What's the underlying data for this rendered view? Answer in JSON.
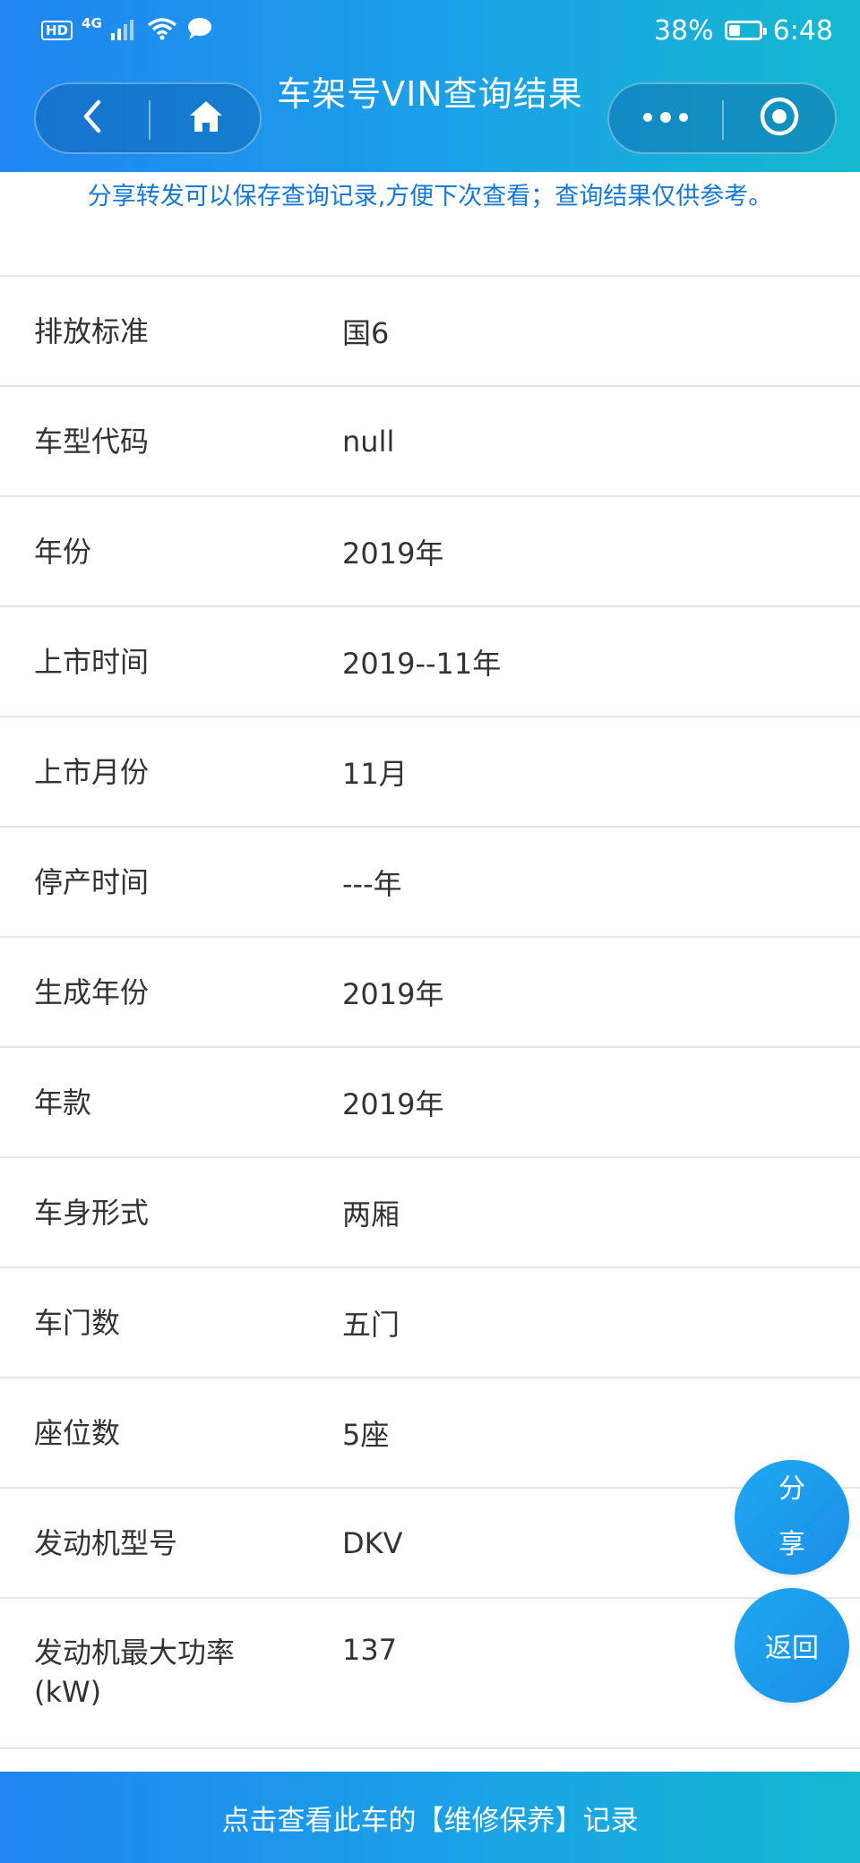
{
  "status_bar": {
    "hd": "HD",
    "network": "4G",
    "battery": "38%",
    "battery_level": 0.38,
    "time": "6:48"
  },
  "nav": {
    "title": "车架号VIN查询结果",
    "back_icon": "chevron-left-icon",
    "home_icon": "home-icon",
    "more_icon": "more-dots-icon",
    "close_icon": "target-circle-icon"
  },
  "notice": "分享转发可以保存查询记录,方便下次查看；查询结果仅供参考。",
  "rows": [
    {
      "label": "",
      "value": ""
    },
    {
      "label": "排放标准",
      "value": "国6"
    },
    {
      "label": "车型代码",
      "value": "null"
    },
    {
      "label": "年份",
      "value": "2019年"
    },
    {
      "label": "上市时间",
      "value": "2019--11年"
    },
    {
      "label": "上市月份",
      "value": "11月"
    },
    {
      "label": "停产时间",
      "value": "---年"
    },
    {
      "label": "生成年份",
      "value": "2019年"
    },
    {
      "label": "年款",
      "value": "2019年"
    },
    {
      "label": "车身形式",
      "value": "两厢"
    },
    {
      "label": "车门数",
      "value": "五门"
    },
    {
      "label": "座位数",
      "value": "5座"
    },
    {
      "label": "发动机型号",
      "value": "DKV"
    },
    {
      "label": "发动机最大功率(kW)",
      "value": "137"
    }
  ],
  "fab": {
    "share_1": "分",
    "share_2": "享",
    "back": "返回"
  },
  "bottom_bar": "点击查看此车的【维修保养】记录",
  "colors": {
    "header_gradient_start": "#1f86f2",
    "header_gradient_end": "#14b8d0",
    "notice_text": "#1578d9",
    "fab": "#1a8ee8"
  }
}
